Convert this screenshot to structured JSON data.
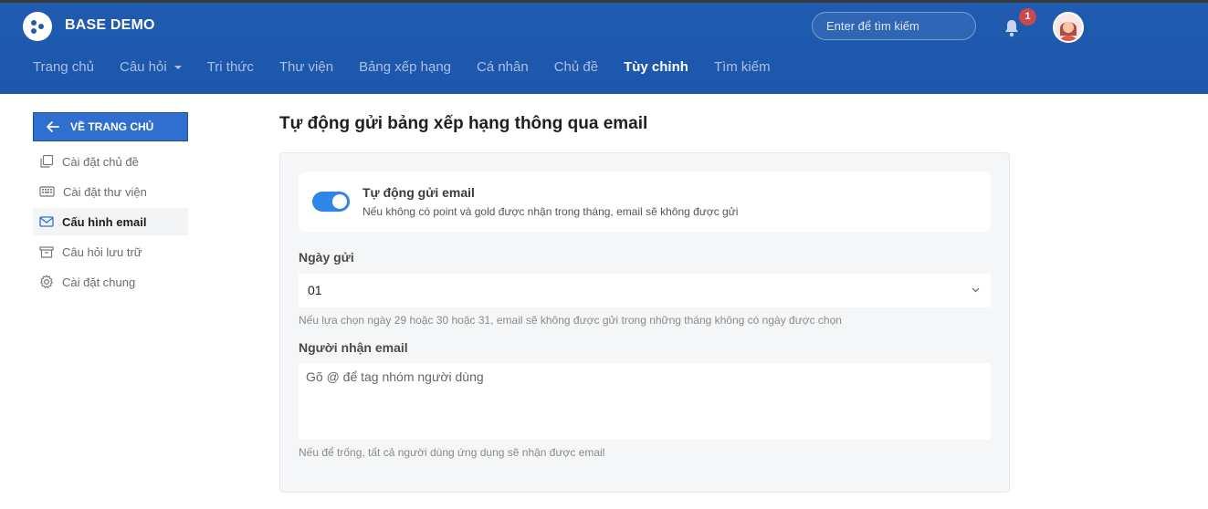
{
  "app": {
    "title": "BASE DEMO"
  },
  "header": {
    "search_placeholder": "Enter để tìm kiếm",
    "notification_count": "1"
  },
  "nav": {
    "items": [
      {
        "label": "Trang chủ"
      },
      {
        "label": "Câu hỏi"
      },
      {
        "label": "Tri thức"
      },
      {
        "label": "Thư viện"
      },
      {
        "label": "Bảng xếp hạng"
      },
      {
        "label": "Cá nhân"
      },
      {
        "label": "Chủ đề"
      },
      {
        "label": "Tùy chỉnh"
      },
      {
        "label": "Tìm kiếm"
      }
    ],
    "active_index": 7
  },
  "sidebar": {
    "back_label": "VỀ TRANG CHỦ",
    "items": [
      {
        "label": "Cài đặt chủ đề",
        "icon": "copy-icon"
      },
      {
        "label": "Cài đặt thư viện",
        "icon": "keyboard-icon"
      },
      {
        "label": "Cấu hình email",
        "icon": "mail-icon"
      },
      {
        "label": "Câu hỏi lưu trữ",
        "icon": "archive-icon"
      },
      {
        "label": "Cài đặt chung",
        "icon": "gear-icon"
      }
    ],
    "active_index": 2
  },
  "main": {
    "title": "Tự động gửi bảng xếp hạng thông qua email",
    "auto_send": {
      "title": "Tự động gửi email",
      "description": "Nếu không có point và gold được nhận trong tháng, email sẽ không được gửi",
      "enabled": true
    },
    "send_day": {
      "label": "Ngày gửi",
      "value": "01",
      "hint": "Nếu lựa chọn ngày 29 hoặc 30 hoặc 31, email sẽ không được gửi trong những tháng không có ngày được chọn"
    },
    "recipients": {
      "label": "Người nhận email",
      "placeholder": "Gõ @ để tag nhóm người dùng",
      "hint": "Nếu để trống, tất cả người dùng ứng dụng sẽ nhận được email"
    }
  },
  "colors": {
    "header_bg": "#1f5bb0",
    "accent": "#2f86e6",
    "badge": "#c94a4a"
  }
}
